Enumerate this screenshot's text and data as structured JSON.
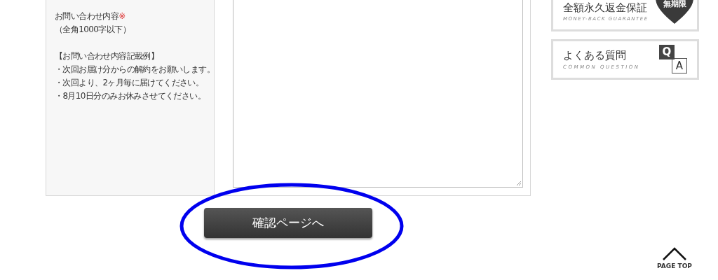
{
  "form": {
    "label": "お問い合わせ内容",
    "required_mark": "※",
    "note": "（全角1000字以下）",
    "example_title": "【お問い合わせ内容記載例】",
    "examples": [
      "・次回お届け分からの解約をお願いします。",
      "・次回より、2ヶ月毎に届けてください。",
      "・8月10日分のみお休みさせてください。"
    ]
  },
  "submit_button": "確認ページへ",
  "sidebar": [
    {
      "kind": "guarantee",
      "title": "全額永久返金保証",
      "subtitle": "MONEY-BACK GUARANTEE",
      "badge": "無期限"
    },
    {
      "kind": "faq",
      "title": "よくある質問",
      "subtitle": "COMMON QUESTION",
      "q": "Q",
      "a": "A"
    }
  ],
  "page_top": "PAGE TOP"
}
